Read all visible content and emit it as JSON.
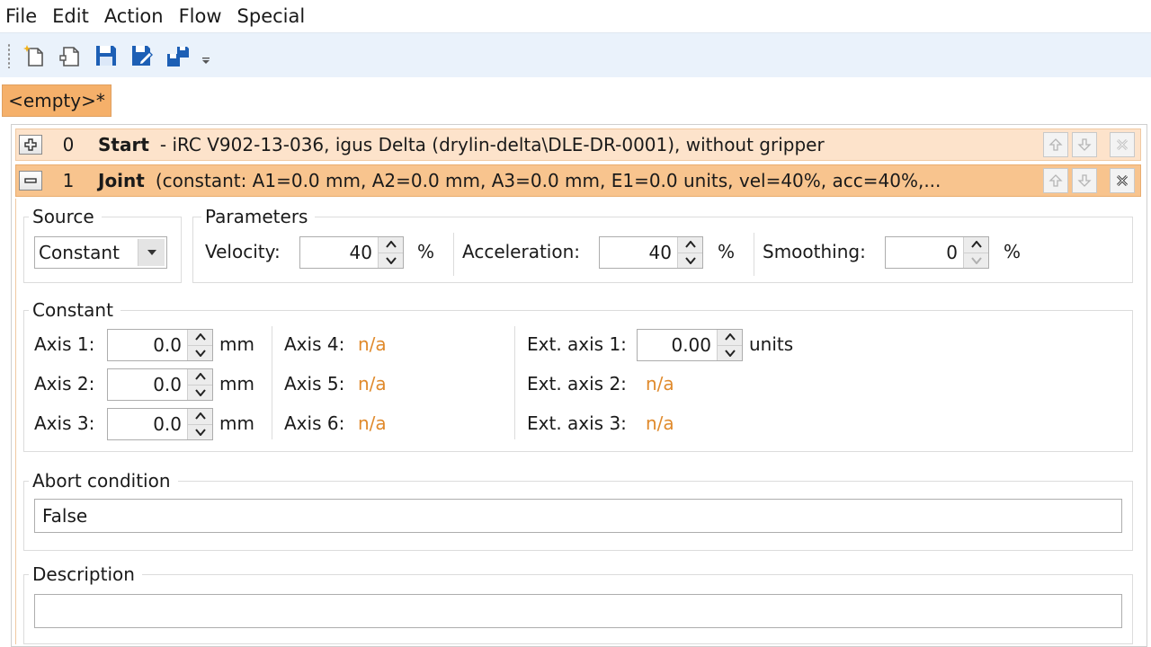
{
  "menu": [
    "File",
    "Edit",
    "Action",
    "Flow",
    "Special"
  ],
  "toolbar_icons": [
    "new-program-icon",
    "open-program-icon",
    "save-icon",
    "save-as-icon",
    "upload-to-robot-icon"
  ],
  "document_tab": "<empty>*",
  "colors": {
    "accent_tab": "#f5b06a",
    "selected_row": "#f8c48e",
    "row": "#fde3cb",
    "na_text": "#e08a2c",
    "toolbar_bg": "#eaf2fb"
  },
  "steps": [
    {
      "index": "0",
      "name": "Start",
      "description": "- iRC V902-13-036, igus Delta (drylin-delta\\DLE-DR-0001), without gripper",
      "expander": "+"
    },
    {
      "index": "1",
      "name": "Joint",
      "description": "(constant: A1=0.0 mm, A2=0.0 mm, A3=0.0 mm, E1=0.0 units, vel=40%, acc=40%,...",
      "expander": "−"
    }
  ],
  "source": {
    "label": "Source",
    "value": "Constant"
  },
  "parameters": {
    "label": "Parameters",
    "velocity_label": "Velocity:",
    "velocity": "40",
    "velocity_unit": "%",
    "acceleration_label": "Acceleration:",
    "acceleration": "40",
    "acceleration_unit": "%",
    "smoothing_label": "Smoothing:",
    "smoothing": "0",
    "smoothing_unit": "%"
  },
  "constant": {
    "label": "Constant",
    "axis1_label": "Axis 1:",
    "axis1": "0.0",
    "axis1_unit": "mm",
    "axis2_label": "Axis 2:",
    "axis2": "0.0",
    "axis2_unit": "mm",
    "axis3_label": "Axis 3:",
    "axis3": "0.0",
    "axis3_unit": "mm",
    "axis4_label": "Axis 4:",
    "axis4": "n/a",
    "axis5_label": "Axis 5:",
    "axis5": "n/a",
    "axis6_label": "Axis 6:",
    "axis6": "n/a",
    "ext1_label": "Ext. axis 1:",
    "ext1": "0.00",
    "ext1_unit": "units",
    "ext2_label": "Ext. axis 2:",
    "ext2": "n/a",
    "ext3_label": "Ext. axis 3:",
    "ext3": "n/a"
  },
  "abort": {
    "label": "Abort condition",
    "value": "False"
  },
  "description": {
    "label": "Description",
    "value": ""
  }
}
